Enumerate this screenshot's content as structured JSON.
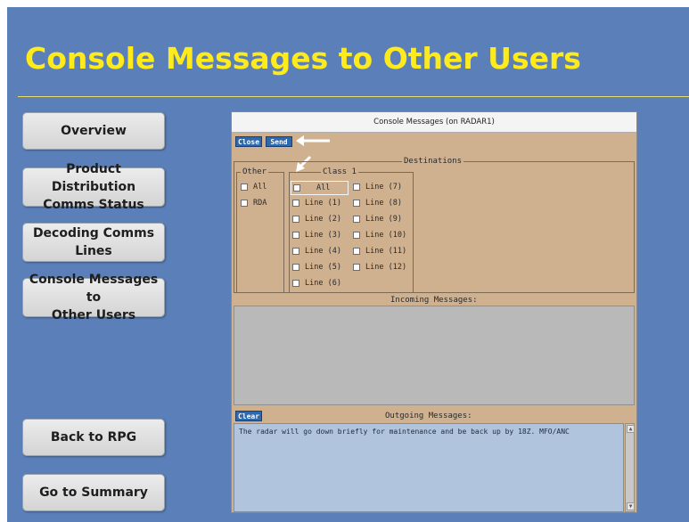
{
  "slide": {
    "title": "Console Messages to Other Users",
    "colors": {
      "background": "#5b80b9",
      "title": "#ffea1c",
      "button": "#dcdcdc"
    }
  },
  "nav": {
    "overview": "Overview",
    "product_distribution_1": "Product Distribution",
    "product_distribution_2": "Comms Status",
    "decoding_1": "Decoding Comms",
    "decoding_2": "Lines",
    "console_1": "Console Messages to",
    "console_2": "Other Users",
    "back": "Back to RPG",
    "summary": "Go to Summary"
  },
  "window": {
    "title": "Console Messages (on RADAR1)",
    "close_label": "Close",
    "send_label": "Send",
    "destinations_label": "Destinations",
    "other_label": "Other",
    "class1_label": "Class 1",
    "other_items": [
      "All",
      "RDA"
    ],
    "class1_col1": [
      "All",
      "Line (1)",
      "Line (2)",
      "Line (3)",
      "Line (4)",
      "Line (5)",
      "Line (6)"
    ],
    "class1_col2": [
      "Line (7)",
      "Line (8)",
      "Line (9)",
      "Line (10)",
      "Line (11)",
      "Line (12)"
    ],
    "incoming_label": "Incoming Messages:",
    "clear_label": "Clear",
    "outgoing_label": "Outgoing Messages:",
    "outgoing_text": "The radar will go down briefly for maintenance and be back up by 18Z. MFO/ANC"
  }
}
